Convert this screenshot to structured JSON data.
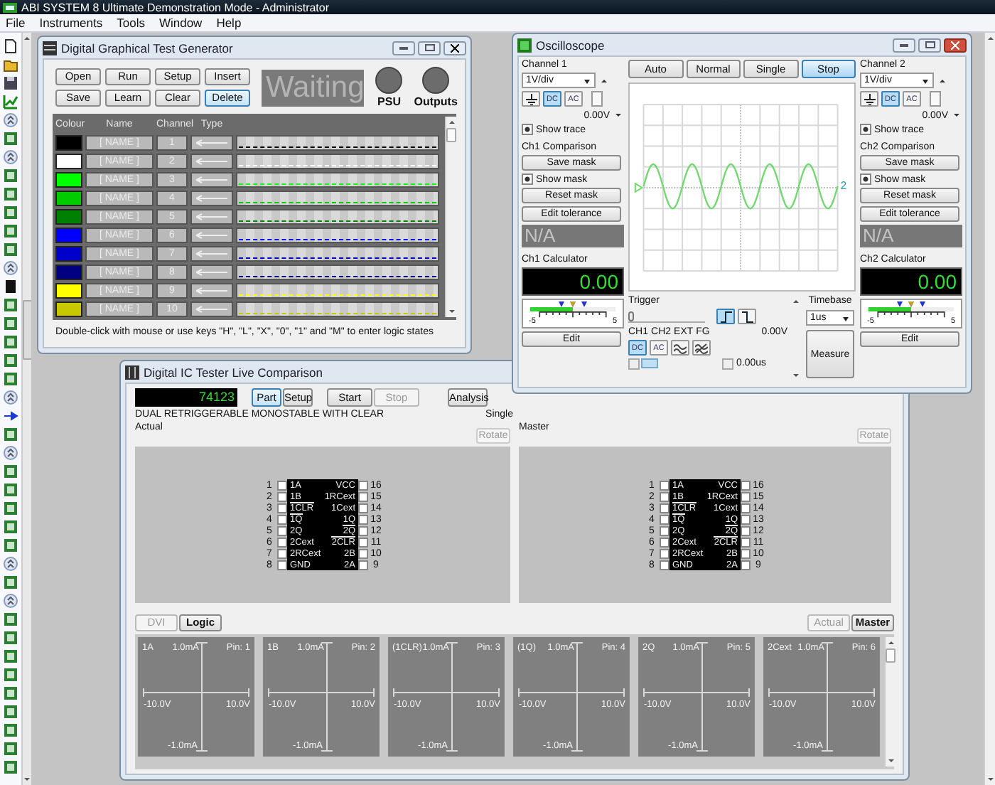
{
  "app": {
    "title": "ABI SYSTEM 8 Ultimate Demonstration Mode - Administrator",
    "menu": [
      "File",
      "Instruments",
      "Tools",
      "Window",
      "Help"
    ]
  },
  "test_generator": {
    "title": "Digital Graphical Test Generator",
    "buttons": [
      {
        "label": "Open",
        "focused": false
      },
      {
        "label": "Run",
        "focused": false
      },
      {
        "label": "Setup",
        "focused": false
      },
      {
        "label": "Insert",
        "focused": false
      },
      {
        "label": "Save",
        "focused": false
      },
      {
        "label": "Learn",
        "focused": false
      },
      {
        "label": "Clear",
        "focused": false
      },
      {
        "label": "Delete",
        "focused": true
      }
    ],
    "status": "Waiting",
    "indicators": [
      {
        "label": "PSU",
        "on": false
      },
      {
        "label": "Outputs",
        "on": false
      }
    ],
    "columns": [
      "Colour",
      "Name",
      "Channel",
      "Type"
    ],
    "rows": [
      {
        "color": "#000000",
        "name": "[ NAME ]",
        "channel": "1"
      },
      {
        "color": "#ffffff",
        "name": "[ NAME ]",
        "channel": "2"
      },
      {
        "color": "#00ff00",
        "name": "[ NAME ]",
        "channel": "3"
      },
      {
        "color": "#00cc00",
        "name": "[ NAME ]",
        "channel": "4"
      },
      {
        "color": "#008000",
        "name": "[ NAME ]",
        "channel": "5"
      },
      {
        "color": "#0000ff",
        "name": "[ NAME ]",
        "channel": "6"
      },
      {
        "color": "#0000cc",
        "name": "[ NAME ]",
        "channel": "7"
      },
      {
        "color": "#000080",
        "name": "[ NAME ]",
        "channel": "8"
      },
      {
        "color": "#ffff00",
        "name": "[ NAME ]",
        "channel": "9"
      },
      {
        "color": "#c8c800",
        "name": "[ NAME ]",
        "channel": "10"
      }
    ],
    "hint": "Double-click with mouse or use keys \"H\", \"L\", \"X\", \"0\", \"1\" and \"M\" to enter logic states"
  },
  "oscilloscope": {
    "title": "Oscilloscope",
    "modes": [
      {
        "label": "Auto",
        "selected": false
      },
      {
        "label": "Normal",
        "selected": false
      },
      {
        "label": "Single",
        "selected": false
      },
      {
        "label": "Stop",
        "selected": true
      }
    ],
    "channels": [
      {
        "label": "Channel 1",
        "scale": "1V/div",
        "coupling": [
          {
            "label": "DC",
            "selected": true
          },
          {
            "label": "AC",
            "selected": false
          }
        ],
        "offset": "0.00V",
        "show_trace": {
          "label": "Show trace",
          "checked": true
        },
        "comparison": {
          "title": "Ch1 Comparison",
          "save": "Save mask",
          "show_mask": {
            "label": "Show mask",
            "checked": true
          },
          "reset": "Reset mask",
          "tolerance": "Edit tolerance",
          "result": "N/A"
        },
        "calculator": {
          "title": "Ch1 Calculator",
          "reading": "0.00",
          "level": 0.5,
          "scale_min": "-5",
          "scale_max": "5",
          "edit": "Edit"
        }
      },
      {
        "label": "Channel 2",
        "scale": "1V/div",
        "coupling": [
          {
            "label": "DC",
            "selected": true
          },
          {
            "label": "AC",
            "selected": false
          }
        ],
        "offset": "0.00V",
        "show_trace": {
          "label": "Show trace",
          "checked": true
        },
        "comparison": {
          "title": "Ch2 Comparison",
          "save": "Save mask",
          "show_mask": {
            "label": "Show mask",
            "checked": true
          },
          "reset": "Reset mask",
          "tolerance": "Edit tolerance",
          "result": "N/A"
        },
        "calculator": {
          "title": "Ch2 Calculator",
          "reading": "0.00",
          "level": 0.5,
          "scale_min": "-5",
          "scale_max": "5",
          "edit": "Edit"
        }
      }
    ],
    "trace_label": "2",
    "trigger": {
      "title": "Trigger",
      "level": 0,
      "edges": [
        {
          "kind": "rising",
          "selected": true
        },
        {
          "kind": "falling",
          "selected": false
        }
      ],
      "sources": [
        "CH1",
        "CH2",
        "EXT",
        "FG"
      ],
      "coupling": [
        {
          "label": "DC",
          "selected": true
        },
        {
          "label": "AC",
          "selected": false
        }
      ],
      "voltage": "0.00V",
      "time": "0.00us"
    },
    "timebase": {
      "title": "Timebase",
      "value": "1us"
    },
    "measure": "Measure"
  },
  "ic_tester": {
    "title": "Digital IC Tester Live Comparison",
    "part_number": "74123",
    "select_buttons": [
      {
        "label": "Part",
        "selected": true
      },
      {
        "label": "Setup",
        "selected": false
      }
    ],
    "run_buttons": [
      {
        "label": "Start",
        "disabled": false
      },
      {
        "label": "Stop",
        "disabled": true
      }
    ],
    "analysis": "Analysis",
    "description": "DUAL RETRIGGERABLE MONOSTABLE WITH CLEAR",
    "mode": "Single",
    "panels": [
      {
        "label": "Actual",
        "rotate": "Rotate",
        "pins_left": [
          {
            "num": "1",
            "name": "1A",
            "inverted": false
          },
          {
            "num": "2",
            "name": "1B",
            "inverted": false
          },
          {
            "num": "3",
            "name": "1CLR",
            "inverted": true
          },
          {
            "num": "4",
            "name": "1Q",
            "inverted": true
          },
          {
            "num": "5",
            "name": "2Q",
            "inverted": false
          },
          {
            "num": "6",
            "name": "2Cext",
            "inverted": false
          },
          {
            "num": "7",
            "name": "2RCext",
            "inverted": false
          },
          {
            "num": "8",
            "name": "GND",
            "inverted": false
          }
        ],
        "pins_right": [
          {
            "num": "16",
            "name": "VCC",
            "inverted": false
          },
          {
            "num": "15",
            "name": "1RCext",
            "inverted": false
          },
          {
            "num": "14",
            "name": "1Cext",
            "inverted": false
          },
          {
            "num": "13",
            "name": "1Q",
            "inverted": false
          },
          {
            "num": "12",
            "name": "2Q",
            "inverted": true
          },
          {
            "num": "11",
            "name": "2CLR",
            "inverted": true
          },
          {
            "num": "10",
            "name": "2B",
            "inverted": false
          },
          {
            "num": "9",
            "name": "2A",
            "inverted": false
          }
        ]
      },
      {
        "label": "Master",
        "rotate": "Rotate",
        "pins_left": [
          {
            "num": "1",
            "name": "1A",
            "inverted": false
          },
          {
            "num": "2",
            "name": "1B",
            "inverted": false
          },
          {
            "num": "3",
            "name": "1CLR",
            "inverted": true
          },
          {
            "num": "4",
            "name": "1Q",
            "inverted": true
          },
          {
            "num": "5",
            "name": "2Q",
            "inverted": false
          },
          {
            "num": "6",
            "name": "2Cext",
            "inverted": false
          },
          {
            "num": "7",
            "name": "2RCext",
            "inverted": false
          },
          {
            "num": "8",
            "name": "GND",
            "inverted": false
          }
        ],
        "pins_right": [
          {
            "num": "16",
            "name": "VCC",
            "inverted": false
          },
          {
            "num": "15",
            "name": "1RCext",
            "inverted": false
          },
          {
            "num": "14",
            "name": "1Cext",
            "inverted": false
          },
          {
            "num": "13",
            "name": "1Q",
            "inverted": false
          },
          {
            "num": "12",
            "name": "2Q",
            "inverted": true
          },
          {
            "num": "11",
            "name": "2CLR",
            "inverted": true
          },
          {
            "num": "10",
            "name": "2B",
            "inverted": false
          },
          {
            "num": "9",
            "name": "2A",
            "inverted": false
          }
        ]
      }
    ],
    "view_tabs": [
      {
        "label": "DVI",
        "selected": false
      },
      {
        "label": "Logic",
        "selected": true
      }
    ],
    "source_tabs": [
      {
        "label": "Actual",
        "selected": false
      },
      {
        "label": "Master",
        "selected": true
      }
    ],
    "plots": [
      {
        "name": "1A",
        "i_max": "1.0mA",
        "pin": "Pin: 1",
        "v_min": "-10.0V",
        "v_max": "10.0V",
        "i_min": "-1.0mA"
      },
      {
        "name": "1B",
        "i_max": "1.0mA",
        "pin": "Pin: 2",
        "v_min": "-10.0V",
        "v_max": "10.0V",
        "i_min": "-1.0mA"
      },
      {
        "name": "(1CLR)",
        "i_max": "1.0mA",
        "pin": "Pin: 3",
        "v_min": "-10.0V",
        "v_max": "10.0V",
        "i_min": "-1.0mA"
      },
      {
        "name": "(1Q)",
        "i_max": "1.0mA",
        "pin": "Pin: 4",
        "v_min": "-10.0V",
        "v_max": "10.0V",
        "i_min": "-1.0mA"
      },
      {
        "name": "2Q",
        "i_max": "1.0mA",
        "pin": "Pin: 5",
        "v_min": "-10.0V",
        "v_max": "10.0V",
        "i_min": "-1.0mA"
      },
      {
        "name": "2Cext",
        "i_max": "1.0mA",
        "pin": "Pin: 6",
        "v_min": "-10.0V",
        "v_max": "10.0V",
        "i_min": "-1.0mA"
      }
    ]
  }
}
